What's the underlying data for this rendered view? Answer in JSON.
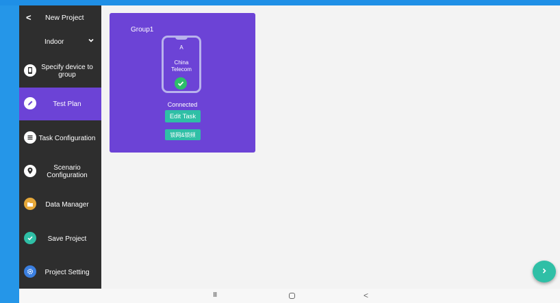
{
  "colors": {
    "accent": "#6c43d6",
    "sidebar_bg": "#2e2e2e",
    "teal": "#2fbfa6",
    "frame_blue": "#2596e8"
  },
  "sidebar": {
    "back_icon": "chevron-left-icon",
    "title": "New Project",
    "filter": {
      "selected": "Indoor",
      "icon": "chevron-down-icon"
    },
    "items": [
      {
        "label": "Specify device to group",
        "icon": "phone-icon",
        "active": false
      },
      {
        "label": "Test Plan",
        "icon": "pencil-icon",
        "active": true
      },
      {
        "label": "Task Configuration",
        "icon": "list-icon",
        "active": false
      },
      {
        "label": "Scenario Configuration",
        "icon": "location-pin-icon",
        "active": false
      },
      {
        "label": "Data Manager",
        "icon": "folder-icon",
        "active": false
      },
      {
        "label": "Save Project",
        "icon": "check-circle-icon",
        "active": false
      },
      {
        "label": "Project Setting",
        "icon": "gear-icon",
        "active": false
      }
    ]
  },
  "main": {
    "group_card": {
      "group_name": "Group1",
      "slot": "A",
      "carrier": "China Telecom",
      "status": "Connected",
      "edit_button": "Edit Task",
      "lock_button": "锁网&锁频"
    },
    "fab_icon": "chevron-right-icon"
  },
  "system_nav": {
    "recents_icon": "recents-icon",
    "home_icon": "home-icon",
    "back_icon": "back-icon"
  }
}
